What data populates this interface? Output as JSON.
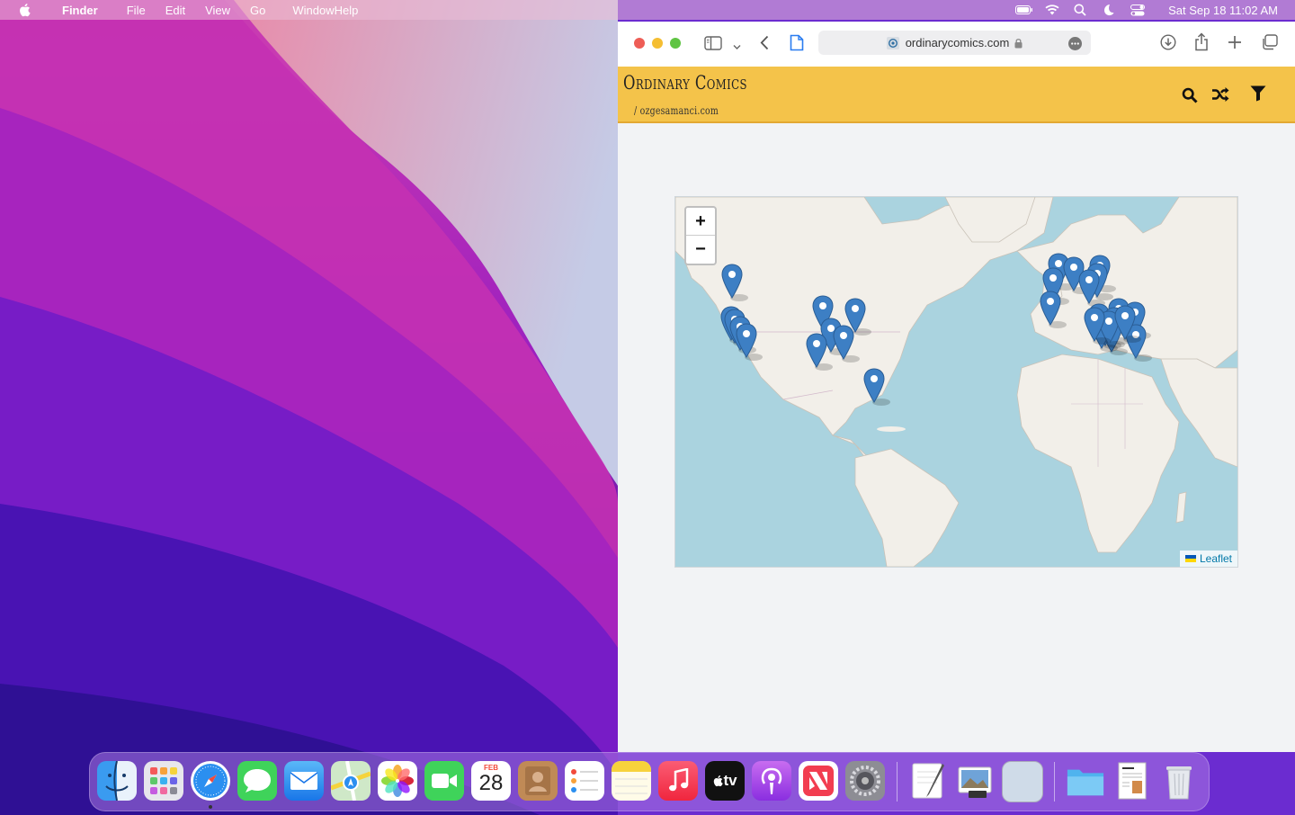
{
  "menubar": {
    "app_name": "Finder",
    "items": [
      "File",
      "Edit",
      "View",
      "Go",
      "WindowHelp"
    ],
    "status_icons": [
      "battery-icon",
      "wifi-icon",
      "spotlight-icon",
      "focus-moon-icon",
      "control-center-icon"
    ],
    "clock": "Sat Sep 18  11:02 AM"
  },
  "safari": {
    "url": "ordinarycomics.com",
    "toolbar_icons": [
      "sidebar-icon",
      "chevron-down-icon",
      "back-icon",
      "page-icon",
      "download-icon",
      "share-icon",
      "new-tab-icon",
      "tab-overview-icon"
    ]
  },
  "site": {
    "title": "Ordinary Comics",
    "subtitle": "/ ozgesamanci.com",
    "header_icons": [
      "search-icon",
      "shuffle-icon",
      "filter-icon"
    ],
    "header_color": "#f4c34a"
  },
  "map": {
    "zoom_in": "+",
    "zoom_out": "−",
    "attribution": "Leaflet",
    "marker_count": 29,
    "marker_color": "#3d7fc4"
  },
  "dock": {
    "apps": [
      "Finder",
      "Launchpad",
      "Safari",
      "Messages",
      "Mail",
      "Maps",
      "Photos",
      "FaceTime",
      "Calendar",
      "Contacts",
      "Reminders",
      "Notes",
      "Music",
      "TV",
      "Podcasts",
      "News",
      "System Preferences",
      "TextEdit",
      "Preview",
      "Blank",
      "Folder",
      "Document",
      "Trash"
    ],
    "calendar_month": "FEB",
    "calendar_day": "28",
    "tv_label": "tv"
  }
}
